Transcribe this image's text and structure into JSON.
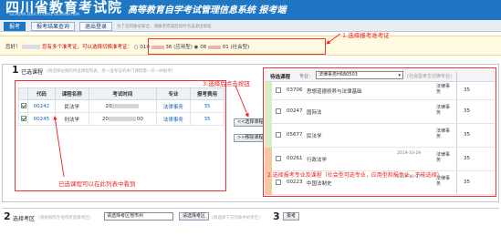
{
  "header": {
    "university_name": "四川省教育考试院",
    "university_en": "SICHUAN EDUCATIONAL EXAMINATION",
    "system_title": "高等教育自学考试管理信息系统 报考端"
  },
  "nav": {
    "tabs": [
      "报考",
      "报考结果查询",
      "退出登录"
    ],
    "tip": "为了您的账号安全，请报考完成后及时点击退出按钮"
  },
  "infobar": {
    "greeting": "您好！",
    "message": "您有多个准考证，可以选择切换准考证：",
    "options": [
      "010",
      "36 (应用型)",
      "08",
      "01 (社会型)"
    ]
  },
  "section1": {
    "number": "1",
    "title": "已选课程",
    "hint": "(请选择右侧的待选课程列表，另一准考证的本门课程需一次一并报考)",
    "columns": [
      "代码",
      "课程名称",
      "考试时间",
      "专业",
      "报考费用"
    ],
    "rows": [
      {
        "code": "00242",
        "name": "民法学",
        "time": "20",
        "time_suffix": "",
        "major": "法律事务",
        "fee": "35"
      },
      {
        "code": "00245",
        "name": "刑法学",
        "time": "20",
        "time_suffix": "00",
        "major": "法律事务",
        "fee": "35"
      }
    ]
  },
  "buttons": {
    "select": "<<选择课程",
    "remove": ">>移除课程"
  },
  "right_panel": {
    "header_label": "待选课程",
    "major_label": "专业：",
    "major_select": "法律事务H680503",
    "note": "(社会型考生切换专业)",
    "rows": [
      {
        "code": "03706",
        "name": "思想道德修养与法律基础",
        "time": "",
        "major": "法律事务",
        "fee": "35",
        "checked": false,
        "stripe": "#d6edc6"
      },
      {
        "code": "00247",
        "name": "国际法",
        "time": "",
        "major": "法律事务",
        "fee": "35",
        "checked": false,
        "stripe": "#d6edc6"
      },
      {
        "code": "05677",
        "name": "民法学",
        "time": "",
        "major": "法律事务",
        "fee": "35",
        "checked": false,
        "stripe": "#d6edc6"
      },
      {
        "code": "00261",
        "name": "行政法学",
        "time": "2019-10-29",
        "major": "法律事务",
        "fee": "35",
        "checked": false,
        "stripe": "#f4c7a5"
      },
      {
        "code": "00223",
        "name": "中国法制史",
        "time": "2019-10-27",
        "major": "法律事务",
        "fee": "35",
        "checked": false,
        "stripe": "#f4c7a5"
      }
    ]
  },
  "section2": {
    "number": "2",
    "title": "选择考区",
    "hint": "(请按照所在地市所选择考区)",
    "select_value": "请选择考区地市州",
    "select_button": "请选择考区",
    "hint2": "(请选择下方列表中的考区)",
    "number3": "3",
    "submit_button": "报考"
  },
  "annotations": {
    "a1": "1.选择报考准考证",
    "a2": "3.选择后点击按钮",
    "a3": "2.选择报考专业及课程（社会型可选专业，应用型和报专业，不能选择）",
    "a4": "已选课程可以在此列表中看到"
  },
  "colors": {
    "header_blue": "#1f76c3",
    "annotation_red": "#e22",
    "info_bg": "#fffbe2"
  }
}
